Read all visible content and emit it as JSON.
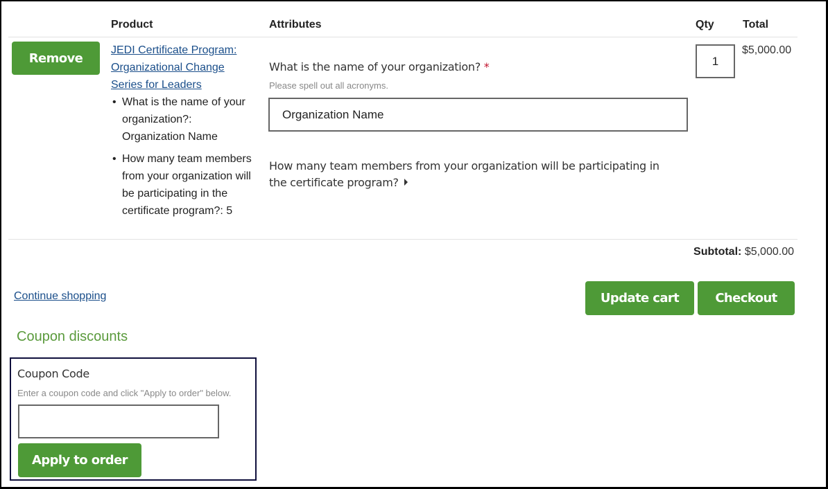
{
  "table": {
    "headers": {
      "product": "Product",
      "attributes": "Attributes",
      "qty": "Qty",
      "total": "Total"
    }
  },
  "row": {
    "remove_label": "Remove",
    "product_link_lines": [
      "JEDI Certificate Program:",
      "Organizational Change",
      "Series for Leaders"
    ],
    "summary_items": [
      {
        "lines": [
          "What is the name of your",
          "organization?:",
          "Organization Name"
        ]
      },
      {
        "lines": [
          "How many team members",
          "from your organization will",
          "be participating in the",
          "certificate program?: 5"
        ]
      }
    ],
    "attr_org": {
      "label": "What is the name of your organization?",
      "required_mark": "*",
      "hint": "Please spell out all acronyms.",
      "value": "Organization Name"
    },
    "attr_team": {
      "lines": [
        "How many team members from your organization will be participating in",
        "the certificate program?"
      ]
    },
    "qty": "1",
    "total": "$5,000.00"
  },
  "subtotal": {
    "label": "Subtotal:",
    "value": "$5,000.00"
  },
  "continue_shopping": "Continue shopping",
  "update_cart_label": "Update cart",
  "checkout_label": "Checkout",
  "coupon": {
    "heading": "Coupon discounts",
    "field_label": "Coupon Code",
    "hint": "Enter a coupon code and click \"Apply to order\" below.",
    "value": "",
    "apply_label": "Apply to order"
  },
  "colors": {
    "button_green": "#4e9a37",
    "link_blue": "#1a4e8a",
    "heading_green": "#5a9a3c",
    "required_red": "#c0112b",
    "coupon_border": "#0f0f3c"
  }
}
